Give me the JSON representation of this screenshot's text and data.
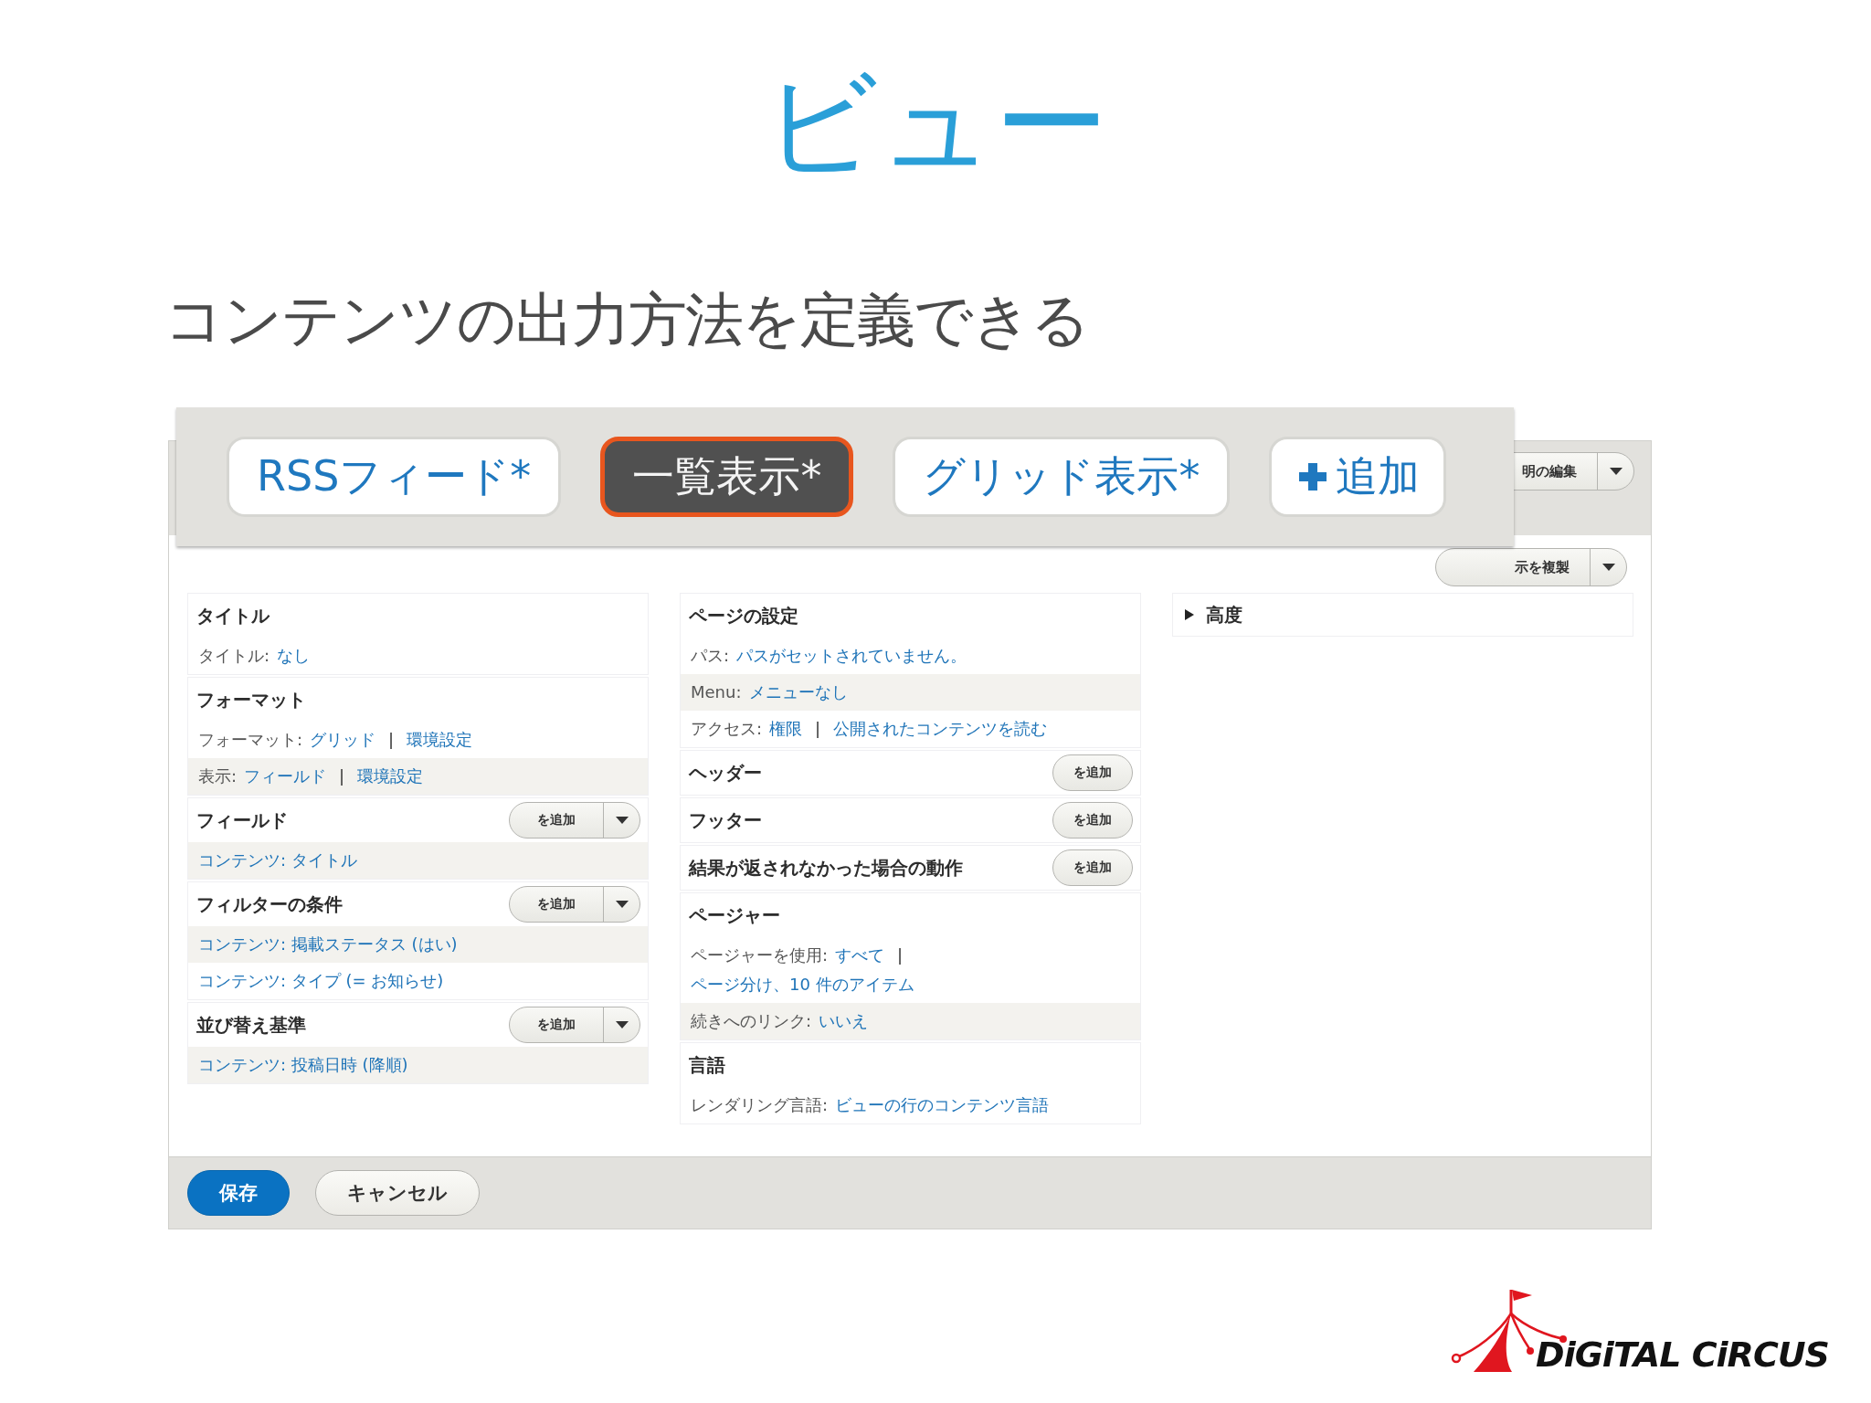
{
  "title": "ビュー",
  "subtitle": "コンテンツの出力方法を定義できる",
  "display_tabs": [
    {
      "label": "RSSフィード*",
      "selected": false,
      "kind": "tab"
    },
    {
      "label": "一覧表示*",
      "selected": true,
      "kind": "tab"
    },
    {
      "label": "グリッド表示*",
      "selected": false,
      "kind": "tab"
    },
    {
      "label": "追加",
      "selected": false,
      "kind": "add"
    }
  ],
  "split_buttons": [
    {
      "label": "明の編集",
      "kind": "band"
    },
    {
      "label": "示を複製",
      "kind": "body"
    }
  ],
  "columns": [
    {
      "sections": [
        {
          "kind": "section",
          "heading": "タイトル",
          "rows": [
            {
              "shaded": false,
              "parts": [
                {
                  "kind": "label",
                  "text": "タイトル:"
                },
                {
                  "kind": "link",
                  "text": "なし"
                }
              ]
            }
          ]
        },
        {
          "kind": "section",
          "heading": "フォーマット",
          "rows": [
            {
              "shaded": false,
              "parts": [
                {
                  "kind": "label",
                  "text": "フォーマット:"
                },
                {
                  "kind": "link",
                  "text": "グリッド"
                },
                {
                  "kind": "sep",
                  "text": "|"
                },
                {
                  "kind": "link",
                  "text": "環境設定"
                }
              ]
            },
            {
              "shaded": true,
              "parts": [
                {
                  "kind": "label",
                  "text": "表示:"
                },
                {
                  "kind": "link",
                  "text": "フィールド"
                },
                {
                  "kind": "sep",
                  "text": "|"
                },
                {
                  "kind": "link",
                  "text": "環境設定"
                }
              ]
            }
          ]
        },
        {
          "kind": "section",
          "heading": "フィールド",
          "add": "を追加",
          "dropdown": true,
          "rows": [
            {
              "shaded": true,
              "parts": [
                {
                  "kind": "link",
                  "text": "コンテンツ: タイトル"
                }
              ]
            }
          ]
        },
        {
          "kind": "section",
          "heading": "フィルターの条件",
          "add": "を追加",
          "dropdown": true,
          "rows": [
            {
              "shaded": true,
              "parts": [
                {
                  "kind": "link",
                  "text": "コンテンツ: 掲載ステータス (はい)"
                }
              ]
            },
            {
              "shaded": false,
              "parts": [
                {
                  "kind": "link",
                  "text": "コンテンツ: タイプ (= お知らせ)"
                }
              ]
            }
          ]
        },
        {
          "kind": "section",
          "heading": "並び替え基準",
          "add": "を追加",
          "dropdown": true,
          "rows": [
            {
              "shaded": true,
              "parts": [
                {
                  "kind": "link",
                  "text": "コンテンツ: 投稿日時 (降順)"
                }
              ]
            }
          ]
        }
      ]
    },
    {
      "sections": [
        {
          "kind": "section",
          "heading": "ページの設定",
          "rows": [
            {
              "shaded": false,
              "parts": [
                {
                  "kind": "label",
                  "text": "パス:"
                },
                {
                  "kind": "link",
                  "text": "パスがセットされていません。"
                }
              ]
            },
            {
              "shaded": true,
              "parts": [
                {
                  "kind": "label",
                  "text": "Menu:"
                },
                {
                  "kind": "link",
                  "text": "メニューなし"
                }
              ]
            },
            {
              "shaded": false,
              "parts": [
                {
                  "kind": "label",
                  "text": "アクセス:"
                },
                {
                  "kind": "link",
                  "text": "権限"
                },
                {
                  "kind": "sep",
                  "text": "|"
                },
                {
                  "kind": "link",
                  "text": "公開されたコンテンツを読む"
                }
              ]
            }
          ]
        },
        {
          "kind": "section",
          "heading": "ヘッダー",
          "add": "を追加",
          "dropdown": false
        },
        {
          "kind": "section",
          "heading": "フッター",
          "add": "を追加",
          "dropdown": false
        },
        {
          "kind": "section",
          "heading": "結果が返されなかった場合の動作",
          "add": "を追加",
          "dropdown": false
        },
        {
          "kind": "section",
          "heading": "ページャー",
          "rows": [
            {
              "shaded": false,
              "parts": [
                {
                  "kind": "label",
                  "text": "ページャーを使用:"
                },
                {
                  "kind": "link",
                  "text": "すべて"
                },
                {
                  "kind": "sep",
                  "text": "|"
                },
                {
                  "kind": "break"
                },
                {
                  "kind": "link",
                  "text": "ページ分け、10 件のアイテム"
                }
              ]
            },
            {
              "shaded": true,
              "parts": [
                {
                  "kind": "label",
                  "text": "続きへのリンク:"
                },
                {
                  "kind": "link",
                  "text": "いいえ"
                }
              ]
            }
          ]
        },
        {
          "kind": "section",
          "heading": "言語",
          "rows": [
            {
              "shaded": false,
              "parts": [
                {
                  "kind": "label",
                  "text": "レンダリング言語:"
                },
                {
                  "kind": "link",
                  "text": "ビューの行のコンテンツ言語"
                }
              ]
            }
          ]
        }
      ]
    },
    {
      "sections": [
        {
          "kind": "collapsible",
          "heading": "高度",
          "expanded": false
        }
      ]
    }
  ],
  "footer_buttons": [
    {
      "label": "保存",
      "kind": "primary"
    },
    {
      "label": "キャンセル",
      "kind": "secondary"
    }
  ],
  "brand": {
    "name": "DiGiTAL CiRCUS"
  }
}
